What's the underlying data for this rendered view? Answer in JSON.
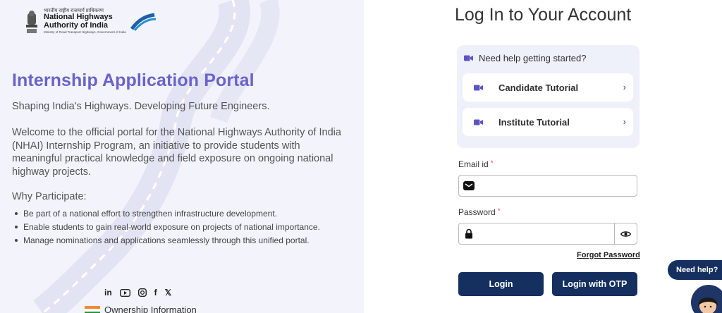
{
  "brand": {
    "hindi_name": "भारतीय राष्ट्रीय राजमार्ग प्राधिकरण",
    "name_line1": "National Highways",
    "name_line2": "Authority of India",
    "ministry": "Ministry of Road Transport Highways, Government of India"
  },
  "intro": {
    "title": "Internship Application Portal",
    "tagline": "Shaping India's Highways. Developing Future Engineers.",
    "welcome": "Welcome to the official portal for the National Highways Authority of India (NHAI) Internship Program, an initiative to provide students with meaningful practical knowledge and field exposure on ongoing national highway projects.",
    "why_heading": "Why Participate:",
    "bullets": [
      "Be part of a national effort to strengthen infrastructure development.",
      "Enable students to gain real-world exposure on projects of national importance.",
      "Manage nominations and applications seamlessly through this unified portal."
    ]
  },
  "footer": {
    "social_icons": [
      "linkedin-icon",
      "youtube-icon",
      "instagram-icon",
      "facebook-icon",
      "x-icon"
    ],
    "linkedin_text": "in",
    "facebook_text": "f",
    "x_text": "𝕏",
    "ownership": "Ownership Information"
  },
  "login": {
    "title": "Log In to Your Account",
    "help_heading": "Need help getting started?",
    "tutorials": [
      "Candidate Tutorial",
      "Institute Tutorial"
    ],
    "email_label": "Email id",
    "email_value": "",
    "password_label": "Password",
    "password_value": "",
    "required_mark": "*",
    "forgot": "Forgot Password",
    "login_button": "Login",
    "otp_button": "Login with OTP"
  },
  "chat": {
    "need_help": "Need help?"
  },
  "colors": {
    "accent": "#6a63c9",
    "navy": "#15305f",
    "left_bg": "#f2f3fb"
  }
}
